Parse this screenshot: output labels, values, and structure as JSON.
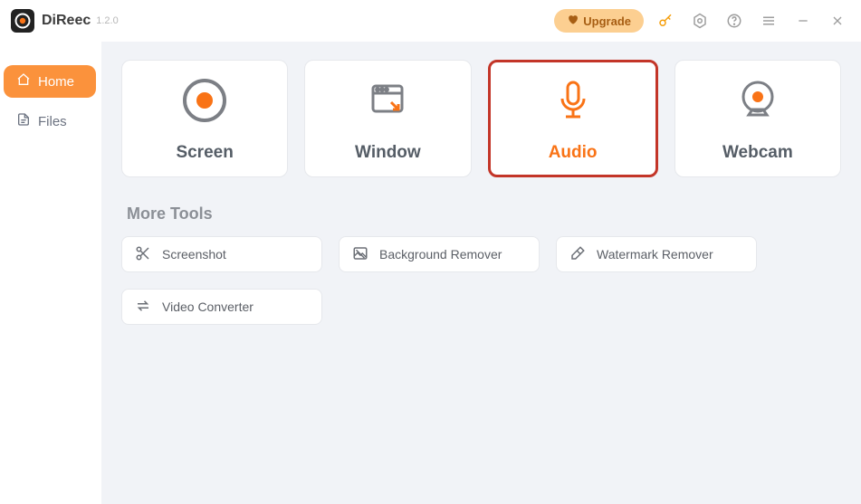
{
  "app": {
    "name": "DiReec",
    "version": "1.2.0"
  },
  "titlebar": {
    "upgrade": "Upgrade"
  },
  "sidebar": {
    "items": [
      {
        "label": "Home",
        "active": true
      },
      {
        "label": "Files",
        "active": false
      }
    ]
  },
  "recorders": [
    {
      "key": "screen",
      "label": "Screen"
    },
    {
      "key": "window",
      "label": "Window"
    },
    {
      "key": "audio",
      "label": "Audio",
      "selected": true
    },
    {
      "key": "webcam",
      "label": "Webcam"
    }
  ],
  "more_tools": {
    "title": "More Tools",
    "items": [
      {
        "label": "Screenshot"
      },
      {
        "label": "Background Remover"
      },
      {
        "label": "Watermark Remover"
      },
      {
        "label": "Video Converter"
      }
    ]
  },
  "colors": {
    "accent": "#f97316",
    "upgrade_bg": "#fccf91",
    "selected_border": "#c33528"
  }
}
